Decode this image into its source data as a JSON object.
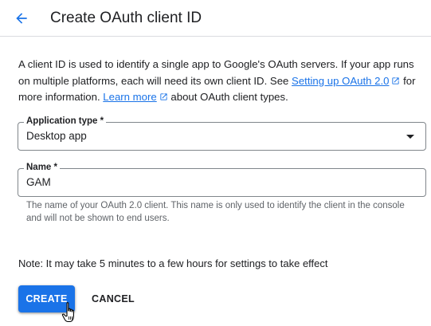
{
  "header": {
    "title": "Create OAuth client ID"
  },
  "description": {
    "text_before_link1": "A client ID is used to identify a single app to Google's OAuth servers. If your app runs on multiple platforms, each will need its own client ID. See ",
    "link1": "Setting up OAuth 2.0",
    "text_between": " for more information. ",
    "link2": "Learn more",
    "text_after": " about OAuth client types."
  },
  "application_type": {
    "label": "Application type *",
    "value": "Desktop app"
  },
  "name_field": {
    "label": "Name *",
    "value": "GAM",
    "hint": "The name of your OAuth 2.0 client. This name is only used to identify the client in the console and will not be shown to end users."
  },
  "note": "Note: It may take 5 minutes to a few hours for settings to take effect",
  "buttons": {
    "create": "CREATE",
    "cancel": "CANCEL"
  },
  "colors": {
    "accent": "#1a73e8",
    "text": "#202124",
    "secondary_text": "#5f6368",
    "border": "#80868b",
    "divider": "#dadce0"
  },
  "icons": {
    "back": "arrow-back-icon",
    "external_link": "open-in-new-icon",
    "dropdown": "arrow-drop-down-icon",
    "cursor": "hand-pointer-cursor"
  }
}
